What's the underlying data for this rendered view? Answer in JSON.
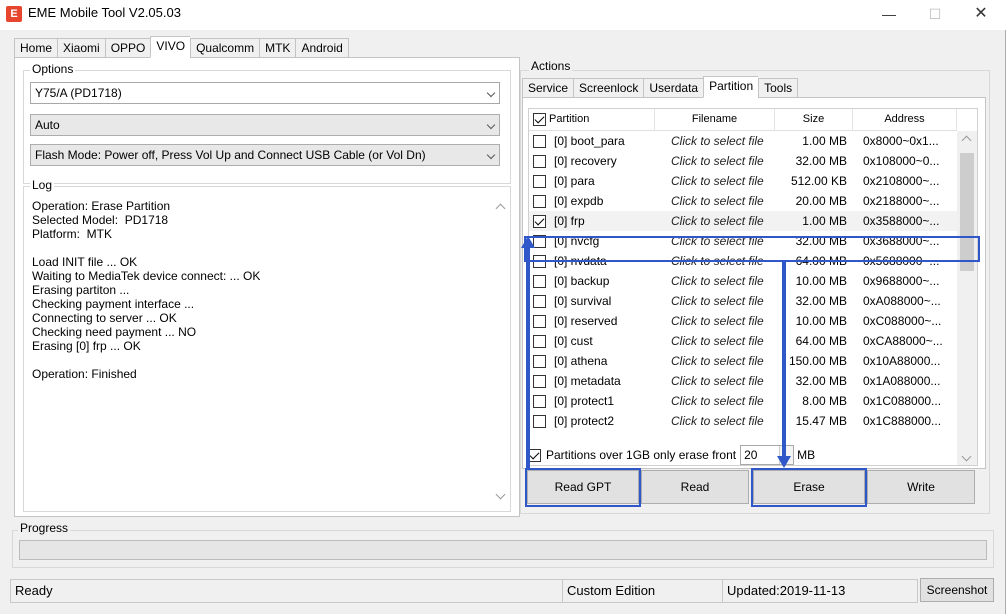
{
  "window": {
    "title": "EME Mobile Tool V2.05.03",
    "logo_text": "E"
  },
  "controls": {
    "minimize": "—",
    "maximize": "☐",
    "close": "✕"
  },
  "main_tabs": [
    "Home",
    "Xiaomi",
    "OPPO",
    "VIVO",
    "Qualcomm",
    "MTK",
    "Android"
  ],
  "main_tabs_active": "VIVO",
  "options": {
    "label": "Options",
    "model": "Y75/A (PD1718)",
    "mode": "Auto",
    "flash_mode": "Flash Mode: Power off, Press Vol Up and Connect USB Cable (or Vol Dn)"
  },
  "log": {
    "label": "Log",
    "lines": "Operation: Erase Partition\nSelected Model:  PD1718\nPlatform:  MTK\n\nLoad INIT file ... OK\nWaiting to MediaTek device connect: ... OK\nErasing partiton ...\nChecking payment interface ...\nConnecting to server ... OK\nChecking need payment ... NO\nErasing [0] frp ... OK\n\nOperation: Finished"
  },
  "actions": {
    "label": "Actions",
    "tabs": [
      "Service",
      "Screenlock",
      "Userdata",
      "Partition",
      "Tools"
    ],
    "active_tab": "Partition",
    "columns": [
      "Partition",
      "Filename",
      "Size",
      "Address"
    ],
    "rows": [
      {
        "name": "[0] boot_para",
        "file": "Click to select file",
        "size": "1.00 MB",
        "addr": "0x8000~0x1...",
        "checked": false
      },
      {
        "name": "[0] recovery",
        "file": "Click to select file",
        "size": "32.00 MB",
        "addr": "0x108000~0...",
        "checked": false
      },
      {
        "name": "[0] para",
        "file": "Click to select file",
        "size": "512.00 KB",
        "addr": "0x2108000~...",
        "checked": false
      },
      {
        "name": "[0] expdb",
        "file": "Click to select file",
        "size": "20.00 MB",
        "addr": "0x2188000~...",
        "checked": false
      },
      {
        "name": "[0] frp",
        "file": "Click to select file",
        "size": "1.00 MB",
        "addr": "0x3588000~...",
        "checked": true
      },
      {
        "name": "[0] nvcfg",
        "file": "Click to select file",
        "size": "32.00 MB",
        "addr": "0x3688000~...",
        "checked": false
      },
      {
        "name": "[0] nvdata",
        "file": "Click to select file",
        "size": "64.00 MB",
        "addr": "0x5688000~...",
        "checked": false
      },
      {
        "name": "[0] backup",
        "file": "Click to select file",
        "size": "10.00 MB",
        "addr": "0x9688000~...",
        "checked": false
      },
      {
        "name": "[0] survival",
        "file": "Click to select file",
        "size": "32.00 MB",
        "addr": "0xA088000~...",
        "checked": false
      },
      {
        "name": "[0] reserved",
        "file": "Click to select file",
        "size": "10.00 MB",
        "addr": "0xC088000~...",
        "checked": false
      },
      {
        "name": "[0] cust",
        "file": "Click to select file",
        "size": "64.00 MB",
        "addr": "0xCA88000~...",
        "checked": false
      },
      {
        "name": "[0] athena",
        "file": "Click to select file",
        "size": "150.00 MB",
        "addr": "0x10A88000...",
        "checked": false
      },
      {
        "name": "[0] metadata",
        "file": "Click to select file",
        "size": "32.00 MB",
        "addr": "0x1A088000...",
        "checked": false
      },
      {
        "name": "[0] protect1",
        "file": "Click to select file",
        "size": "8.00 MB",
        "addr": "0x1C088000...",
        "checked": false
      },
      {
        "name": "[0] protect2",
        "file": "Click to select file",
        "size": "15.47 MB",
        "addr": "0x1C888000...",
        "checked": false
      }
    ],
    "erase_option_label": "Partitions over 1GB only erase front",
    "erase_option_value": "20",
    "erase_option_unit": "MB",
    "buttons": {
      "read_gpt": "Read GPT",
      "read": "Read",
      "erase": "Erase",
      "write": "Write"
    }
  },
  "progress": {
    "label": "Progress",
    "value": 0
  },
  "status": {
    "state": "Ready",
    "edition": "Custom Edition",
    "updated": "Updated:2019-11-13",
    "screenshot": "Screenshot"
  },
  "colors": {
    "highlight": "#2f57c9",
    "logo": "#e8452f"
  }
}
